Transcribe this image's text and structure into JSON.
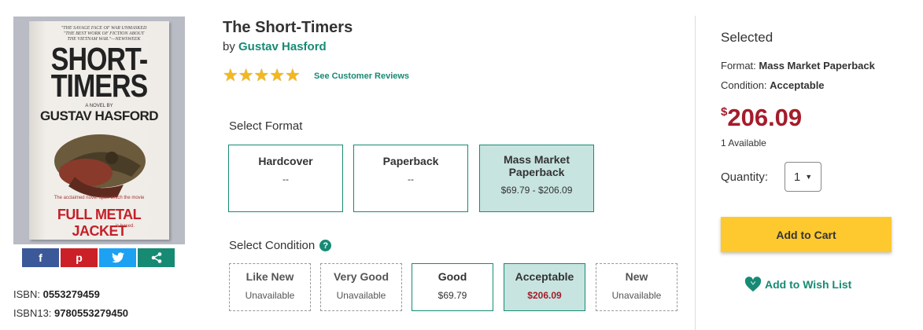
{
  "product": {
    "title": "The Short-Timers",
    "by_label": "by",
    "author": "Gustav Hasford",
    "reviews_link": "See Customer Reviews",
    "rating_stars": 5,
    "cover": {
      "tagline": "\"THE SAVAGE FACE OF WAR UNMASKED \"THE BEST WORK OF FICTION ABOUT THE VIETNAM WAR.\"—NEWSWEEK",
      "title_line1": "SHORT-",
      "title_line2": "TIMERS",
      "title_prefix": "THE",
      "novel_by": "A NOVEL BY",
      "author": "GUSTAV HASFORD",
      "blurb": "The acclaimed novel upon which the movie",
      "movie": "FULL METAL JACKET",
      "based": "is based."
    },
    "isbn_label": "ISBN:",
    "isbn": "0553279459",
    "isbn13_label": "ISBN13:",
    "isbn13": "9780553279450"
  },
  "share": {
    "facebook_icon": "facebook-icon",
    "pinterest_icon": "pinterest-icon",
    "twitter_icon": "twitter-icon",
    "share_icon": "share-icon"
  },
  "format_section": {
    "label": "Select Format",
    "options": [
      {
        "name": "Hardcover",
        "price": "--"
      },
      {
        "name": "Paperback",
        "price": "--"
      },
      {
        "name": "Mass Market Paperback",
        "price": "$69.79 - $206.09"
      }
    ],
    "selected": "Mass Market Paperback"
  },
  "condition_section": {
    "label": "Select Condition",
    "help_icon": "?",
    "options": [
      {
        "name": "Like New",
        "price": "Unavailable"
      },
      {
        "name": "Very Good",
        "price": "Unavailable"
      },
      {
        "name": "Good",
        "price": "$69.79"
      },
      {
        "name": "Acceptable",
        "price": "$206.09"
      },
      {
        "name": "New",
        "price": "Unavailable"
      }
    ],
    "selected": "Acceptable"
  },
  "selected_panel": {
    "heading": "Selected",
    "format_label": "Format:",
    "format_value": "Mass Market Paperback",
    "condition_label": "Condition:",
    "condition_value": "Acceptable",
    "currency": "$",
    "price": "206.09",
    "availability": "1 Available",
    "quantity_label": "Quantity:",
    "quantity_value": "1",
    "add_to_cart": "Add to Cart",
    "wishlist": "Add to Wish List"
  },
  "colors": {
    "accent": "#178a74",
    "price": "#a51c2b",
    "cart_button": "#fdc92f",
    "selected_bg": "#c7e4e0"
  }
}
